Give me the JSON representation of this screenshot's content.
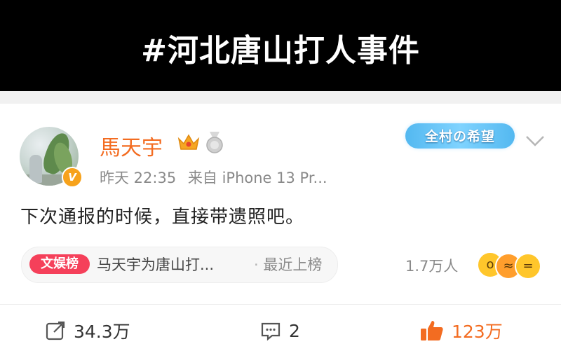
{
  "banner": {
    "title": "#河北唐山打人事件"
  },
  "post": {
    "username": "馬天宇",
    "verified_badge": "V",
    "time": "昨天 22:35",
    "source": "来自 iPhone 13 Pr...",
    "tag_label": "全村の希望",
    "content": "下次通报的时候，直接带遗照吧。",
    "hot_badge": "文娱榜",
    "hot_topic": "马天宇为唐山打...",
    "hot_separator": "·",
    "hot_status": "最近上榜",
    "reaction_count": "1.7万人"
  },
  "actions": {
    "repost_count": "34.3万",
    "comment_count": "2",
    "like_count": "123万"
  },
  "colors": {
    "accent_orange": "#f36c21",
    "hot_red": "#f5405a",
    "banner_bg": "#000000"
  },
  "icons": [
    "crown-icon",
    "medal-icon",
    "chevron-down-icon",
    "repost-icon",
    "comment-icon",
    "thumbs-up-icon"
  ]
}
